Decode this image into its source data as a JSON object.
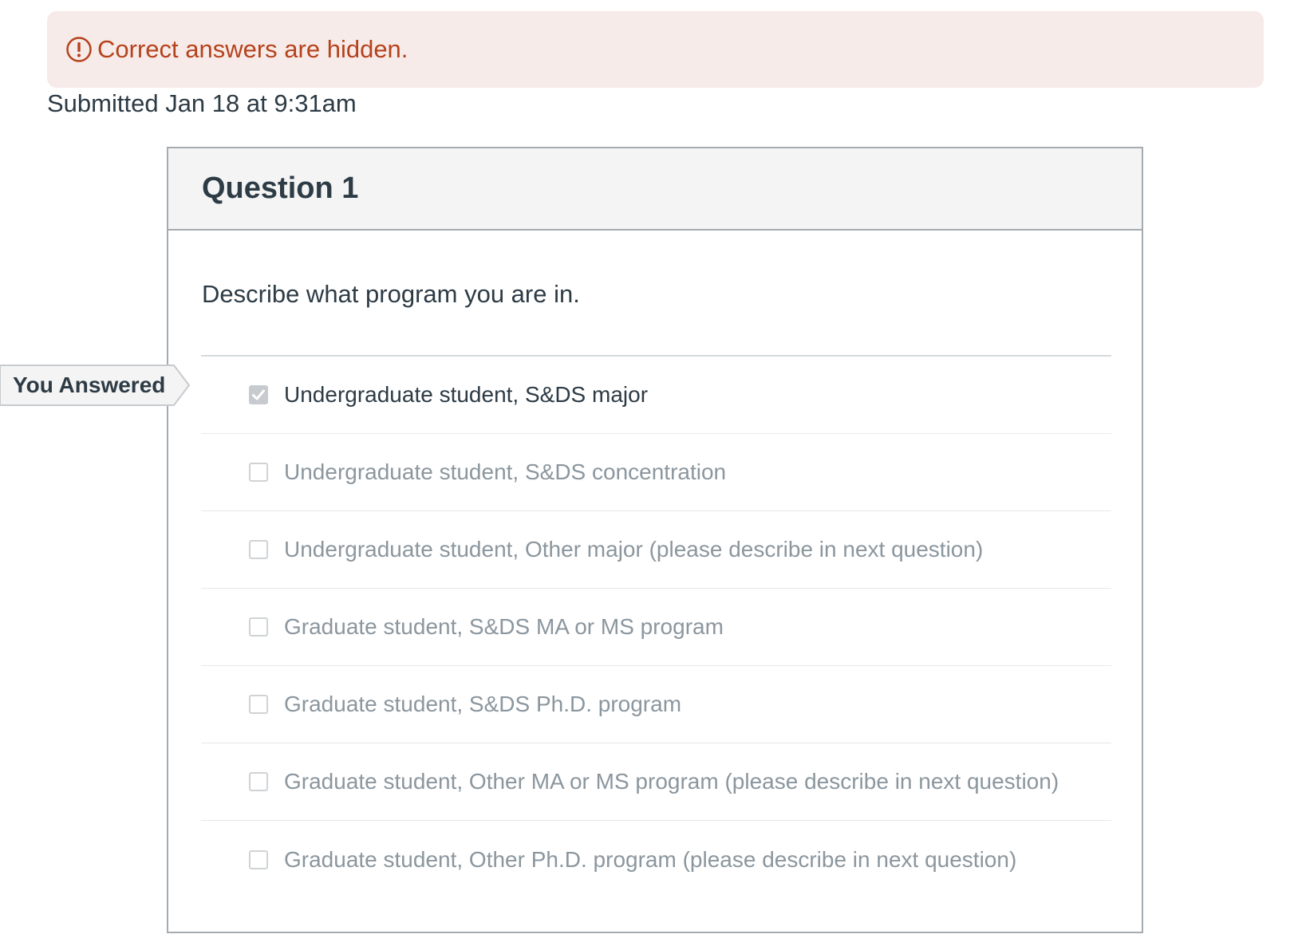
{
  "alert": {
    "icon": "exclamation-circle-icon",
    "text": "Correct answers are hidden.",
    "color": "#b6421d",
    "background": "#f6ebe8"
  },
  "submission": {
    "text": "Submitted Jan 18 at 9:31am"
  },
  "question": {
    "title": "Question 1",
    "prompt": "Describe what program you are in.",
    "you_answered_label": "You Answered",
    "answers": [
      {
        "label": "Undergraduate student, S&DS major",
        "checked": true
      },
      {
        "label": "Undergraduate student, S&DS concentration",
        "checked": false
      },
      {
        "label": "Undergraduate student, Other major (please describe in next question)",
        "checked": false
      },
      {
        "label": "Graduate student, S&DS MA or MS program",
        "checked": false
      },
      {
        "label": "Graduate student, S&DS Ph.D. program",
        "checked": false
      },
      {
        "label": "Graduate student, Other MA or MS program (please describe in next question)",
        "checked": false
      },
      {
        "label": "Graduate student, Other Ph.D. program (please describe in next question)",
        "checked": false
      }
    ]
  }
}
